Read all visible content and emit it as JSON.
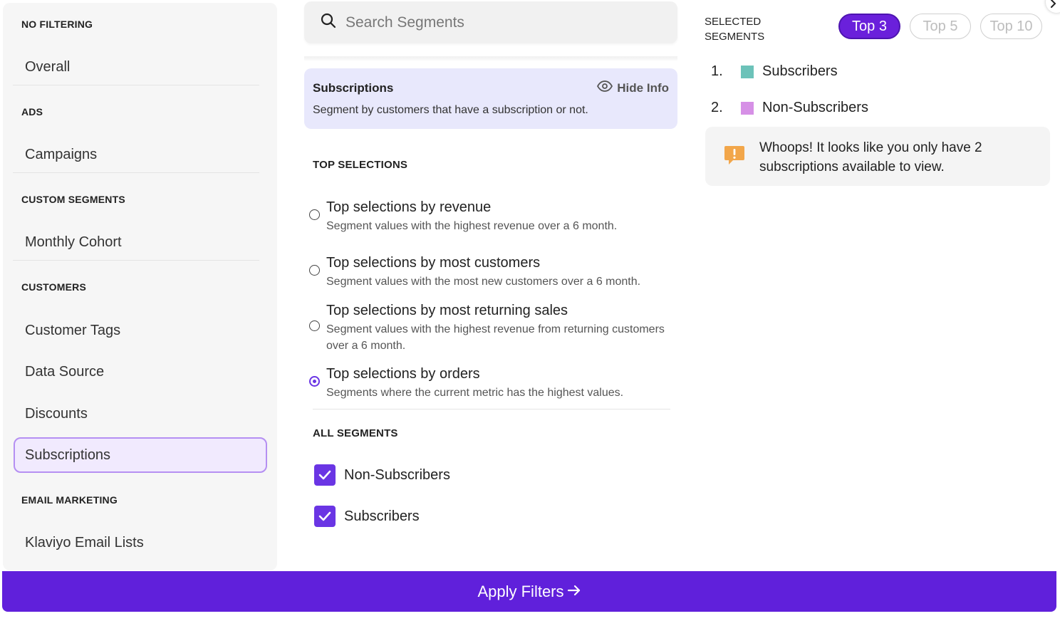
{
  "sidebar": {
    "sections": [
      {
        "header": "NO FILTERING",
        "items": [
          "Overall"
        ]
      },
      {
        "header": "ADS",
        "items": [
          "Campaigns"
        ]
      },
      {
        "header": "CUSTOM SEGMENTS",
        "items": [
          "Monthly Cohort"
        ]
      },
      {
        "header": "CUSTOMERS",
        "items": [
          "Customer Tags",
          "Data Source",
          "Discounts",
          "Subscriptions"
        ]
      },
      {
        "header": "EMAIL MARKETING",
        "items": [
          "Klaviyo Email Lists"
        ]
      }
    ],
    "active_item": "Subscriptions"
  },
  "search": {
    "placeholder": "Search Segments",
    "value": ""
  },
  "info": {
    "title": "Subscriptions",
    "description": "Segment by customers that have a subscription or not.",
    "hide_label": "Hide Info"
  },
  "top_selections": {
    "label": "TOP SELECTIONS",
    "options": [
      {
        "title": "Top selections by revenue",
        "description": "Segment values with the highest revenue over a 6 month.",
        "selected": false
      },
      {
        "title": "Top selections by most customers",
        "description": "Segment values with the most new customers over a 6 month.",
        "selected": false
      },
      {
        "title": "Top selections by most returning sales",
        "description": "Segment values with the highest revenue from returning customers over a 6 month.",
        "selected": false
      },
      {
        "title": "Top selections by orders",
        "description": "Segments where the current metric has the highest values.",
        "selected": true
      }
    ]
  },
  "all_segments": {
    "label": "ALL SEGMENTS",
    "items": [
      {
        "label": "Non-Subscribers",
        "checked": true
      },
      {
        "label": "Subscribers",
        "checked": true
      }
    ]
  },
  "selected": {
    "label": "SELECTED SEGMENTS",
    "pills": [
      "Top 3",
      "Top 5",
      "Top 10"
    ],
    "active_pill": "Top 3",
    "items": [
      {
        "num": "1.",
        "label": "Subscribers",
        "color": "#6cc2b9"
      },
      {
        "num": "2.",
        "label": "Non-Subscribers",
        "color": "#d690e6"
      }
    ],
    "warning": "Whoops! It looks like you only have 2 subscriptions available to view.",
    "warning_color": "#f2a64a"
  },
  "apply": {
    "label": "Apply Filters"
  },
  "colors": {
    "accent": "#6020db",
    "active_border": "#b58ff2"
  }
}
